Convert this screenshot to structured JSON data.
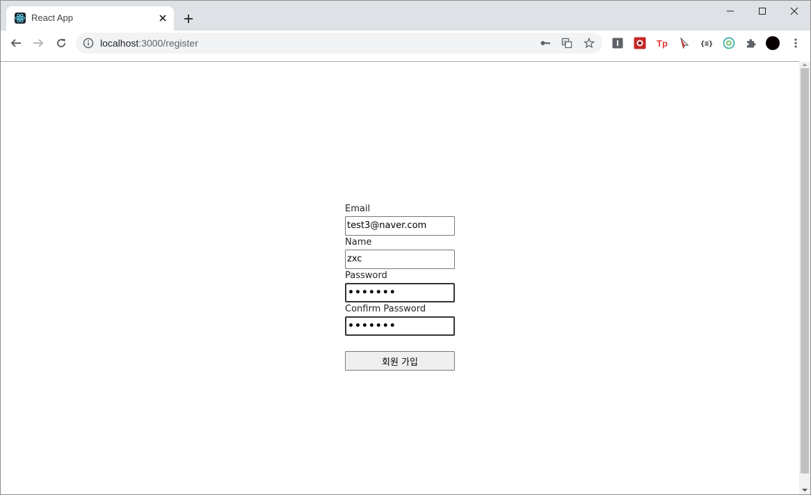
{
  "browser": {
    "tab": {
      "title": "React App"
    },
    "address_bar": {
      "host": "localhost",
      "path": ":3000/register"
    },
    "icons": {
      "favicon": "react-logo-icon",
      "close_tab": "close-icon",
      "new_tab": "plus-icon",
      "back": "arrow-left-icon",
      "forward": "arrow-right-icon",
      "reload": "reload-icon",
      "site_info": "info-icon",
      "password_key": "key-icon",
      "translate": "translate-icon",
      "bookmark": "star-icon",
      "extensions": "puzzle-icon",
      "profile": "avatar",
      "menu": "kebab-menu-icon"
    }
  },
  "register_form": {
    "email_label": "Email",
    "email_value": "test3@naver.com",
    "name_label": "Name",
    "name_value": "zxc",
    "password_label": "Password",
    "password_value": "•••••••",
    "confirm_password_label": "Confirm Password",
    "confirm_password_value": "•••••••",
    "submit_label": "회원 가입"
  },
  "colors": {
    "tabstrip": "#dee1e6",
    "omnibox": "#f1f3f4",
    "button_bg": "#efefef",
    "input_border": "#767676"
  }
}
